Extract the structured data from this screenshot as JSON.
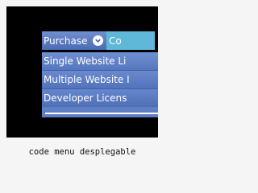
{
  "menu": {
    "top_items": [
      {
        "label": "Purchase",
        "icon": "chevron-down-icon"
      },
      {
        "label": "Co"
      }
    ],
    "submenu_items": [
      {
        "label": "Single Website Li"
      },
      {
        "label": "Multiple Website I"
      },
      {
        "label": "Developer Licens"
      }
    ]
  },
  "caption": "code menu desplegable",
  "colors": {
    "frame_bg": "#000000",
    "menu_blue": "#5f7fc5",
    "contact_teal": "#5fb8d8",
    "page_bg": "#f5f5f5"
  }
}
